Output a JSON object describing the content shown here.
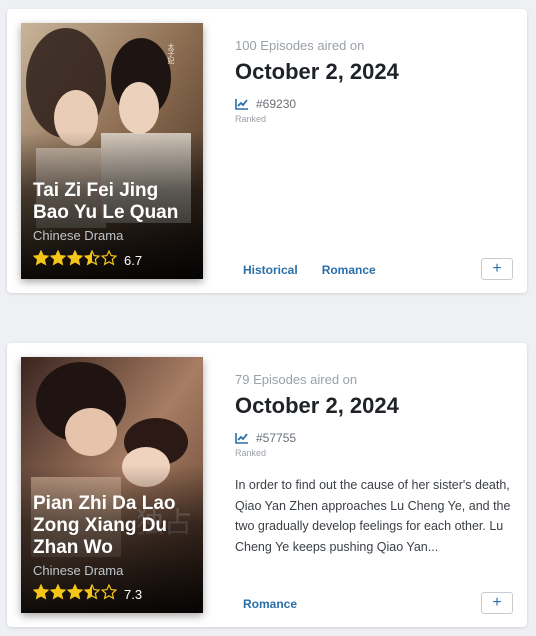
{
  "cards": [
    {
      "title": "Tai Zi Fei Jing Bao Yu Le Quan",
      "type": "Chinese Drama",
      "rating": 3.5,
      "score": "6.7",
      "episodes_text": "100 Episodes aired on",
      "date": "October 2, 2024",
      "rank": "#69230",
      "ranked_label": "Ranked",
      "description": "",
      "genres": [
        "Historical",
        "Romance"
      ],
      "add_label": "+"
    },
    {
      "title": "Pian Zhi Da Lao Zong Xiang Du Zhan Wo",
      "type": "Chinese Drama",
      "rating": 3.5,
      "score": "7.3",
      "episodes_text": "79 Episodes aired on",
      "date": "October 2, 2024",
      "rank": "#57755",
      "ranked_label": "Ranked",
      "description": "In order to find out the cause of her sister's death, Qiao Yan Zhen approaches Lu Cheng Ye, and the two gradually develop feelings for each other. Lu Cheng Ye keeps pushing Qiao Yan...",
      "genres": [
        "Romance"
      ],
      "add_label": "+"
    }
  ],
  "colors": {
    "accent": "#2a6fa8",
    "star": "#f5c518"
  },
  "icons": {
    "rank": "trend-chart-icon",
    "star": "star-icon"
  }
}
